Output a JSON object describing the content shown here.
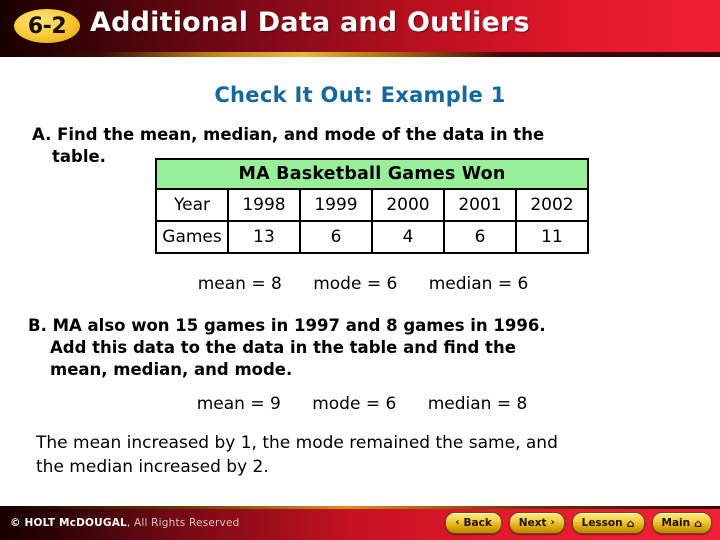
{
  "header": {
    "badge": "6-2",
    "title": "Additional Data and Outliers",
    "brand_red": "#ED1C35",
    "badge_gold": "#F6CF41"
  },
  "example": {
    "title": "Check It Out: Example 1",
    "title_color": "#14689C"
  },
  "problems": {
    "a": {
      "line1": "A. Find the mean, median, and mode of the data in the",
      "line2": "table."
    },
    "b": {
      "line1": "B. MA also won 15 games in 1997 and 8 games in 1996.",
      "line2": "Add this data to the data in the table and find the",
      "line3": "mean, median, and mode."
    }
  },
  "table": {
    "caption": "MA Basketball Games Won",
    "caption_bg": "#97F098",
    "row_labels": [
      "Year",
      "Games"
    ],
    "years": [
      "1998",
      "1999",
      "2000",
      "2001",
      "2002"
    ],
    "games": [
      "13",
      "6",
      "4",
      "6",
      "11"
    ]
  },
  "answers": {
    "a": {
      "mean": "mean = 8",
      "mode": "mode = 6",
      "median": "median = 6"
    },
    "b": {
      "mean": "mean = 9",
      "mode": "mode = 6",
      "median": "median = 8"
    }
  },
  "conclusion": {
    "line1": "The mean increased by 1, the mode remained the same, and",
    "line2": "the median increased by 2."
  },
  "footer": {
    "copyright_brand": "© HOLT McDOUGAL",
    "copyright_rest": ", All Rights Reserved",
    "buttons": [
      {
        "label": "Back",
        "icon": "chevron-left-icon",
        "glyph": "‹",
        "icon_side": "left"
      },
      {
        "label": "Next",
        "icon": "chevron-right-icon",
        "glyph": "›",
        "icon_side": "right"
      },
      {
        "label": "Lesson",
        "icon": "home-icon",
        "glyph": "⌂",
        "icon_side": "right"
      },
      {
        "label": "Main",
        "icon": "home-icon",
        "glyph": "⌂",
        "icon_side": "right"
      }
    ]
  },
  "chart_data": {
    "type": "table",
    "title": "MA Basketball Games Won",
    "categories": [
      "1998",
      "1999",
      "2000",
      "2001",
      "2002"
    ],
    "values": [
      13,
      6,
      4,
      6,
      11
    ],
    "xlabel": "Year",
    "ylabel": "Games",
    "additional_points": [
      {
        "year": "1997",
        "games": 15
      },
      {
        "year": "1996",
        "games": 8
      }
    ],
    "statistics_original": {
      "mean": 8,
      "mode": 6,
      "median": 6
    },
    "statistics_with_additional": {
      "mean": 9,
      "mode": 6,
      "median": 8
    }
  }
}
